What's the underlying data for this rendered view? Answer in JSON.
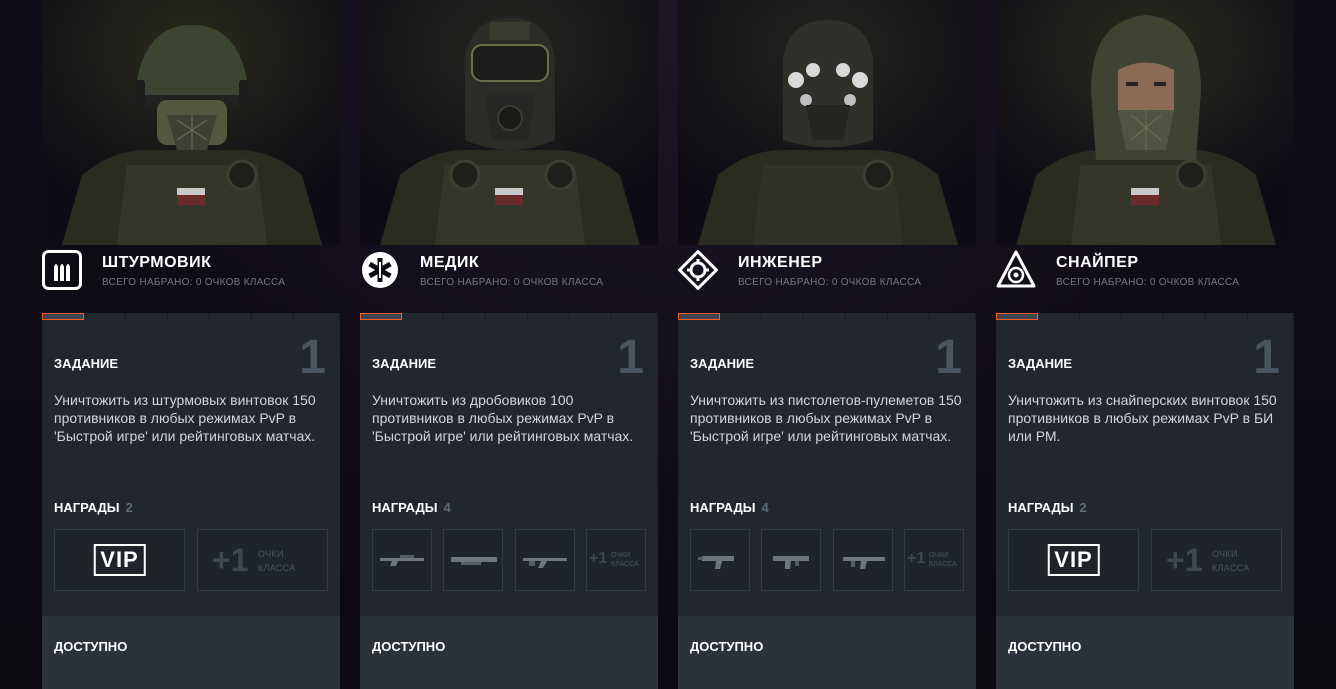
{
  "classes": [
    {
      "name": "ШТУРМОВИК",
      "subtitle": "ВСЕГО НАБРАНО: 0 ОЧКОВ КЛАССА",
      "icon": "ammo-icon",
      "task_label": "ЗАДАНИЕ",
      "task_number": "1",
      "task_text": "Уничтожить из штурмовых винтовок 150 противников в любых режимах PvP в 'Быстрой игре' или рейтинговых матчах.",
      "rewards_label": "НАГРАДЫ",
      "rewards_count": "2",
      "vip_label": "VIP",
      "plus_value": "+1",
      "plus_label": "ОЧКИ КЛАССА",
      "available_label": "ДОСТУПНО"
    },
    {
      "name": "МЕДИК",
      "subtitle": "ВСЕГО НАБРАНО: 0 ОЧКОВ КЛАССА",
      "icon": "medic-icon",
      "task_label": "ЗАДАНИЕ",
      "task_number": "1",
      "task_text": "Уничтожить из дробовиков 100 противников в любых режимах PvP в 'Быстрой игре' или рейтинговых матчах.",
      "rewards_label": "НАГРАДЫ",
      "rewards_count": "4",
      "plus_value": "+1",
      "plus_label": "ОЧКИ КЛАССА",
      "available_label": "ДОСТУПНО"
    },
    {
      "name": "ИНЖЕНЕР",
      "subtitle": "ВСЕГО НАБРАНО: 0 ОЧКОВ КЛАССА",
      "icon": "engineer-icon",
      "task_label": "ЗАДАНИЕ",
      "task_number": "1",
      "task_text": "Уничтожить из пистолетов-пулеметов 150 противников в любых режимах PvP в 'Быстрой игре' или рейтинговых матчах.",
      "rewards_label": "НАГРАДЫ",
      "rewards_count": "4",
      "plus_value": "+1",
      "plus_label": "ОЧКИ КЛАССА",
      "available_label": "ДОСТУПНО"
    },
    {
      "name": "СНАЙПЕР",
      "subtitle": "ВСЕГО НАБРАНО: 0 ОЧКОВ КЛАССА",
      "icon": "sniper-icon",
      "task_label": "ЗАДАНИЕ",
      "task_number": "1",
      "task_text": "Уничтожить из снайперских винтовок 150 противников в любых режимах PvP в БИ или РМ.",
      "rewards_label": "НАГРАДЫ",
      "rewards_count": "2",
      "vip_label": "VIP",
      "plus_value": "+1",
      "plus_label": "ОЧКИ КЛАССА",
      "available_label": "ДОСТУПНО"
    }
  ],
  "colors": {
    "accent": "#ff5a1f",
    "card": "#21272d",
    "available_bar": "#2b323a"
  }
}
